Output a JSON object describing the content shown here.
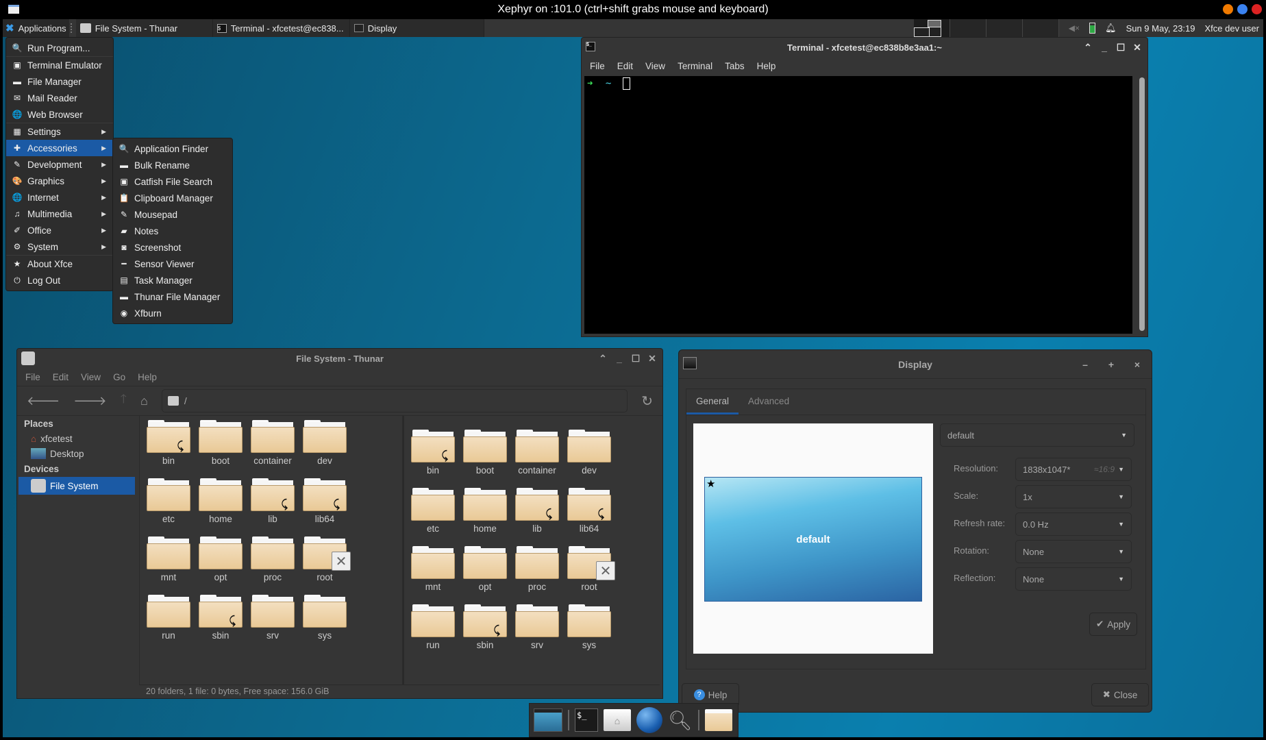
{
  "xephyr": {
    "title": "Xephyr on :101.0 (ctrl+shift grabs mouse and keyboard)",
    "dots": [
      "#f07a00",
      "#3a82f0",
      "#dd2222"
    ]
  },
  "panel": {
    "applications_label": "Applications",
    "tasks": [
      {
        "label": "File System - Thunar",
        "icon": "drive-icon"
      },
      {
        "label": "Terminal - xfcetest@ec838...",
        "icon": "terminal-icon"
      },
      {
        "label": "Display",
        "icon": "monitor-icon"
      }
    ],
    "clock": "Sun  9 May, 23:19",
    "user": "Xfce dev user"
  },
  "app_menu": {
    "items": [
      {
        "label": "Run Program...",
        "icon": "search-icon",
        "glyph": "🔍"
      },
      {
        "label": "Terminal Emulator",
        "icon": "terminal-icon",
        "glyph": "▣"
      },
      {
        "label": "File Manager",
        "icon": "folder-icon",
        "glyph": "▬"
      },
      {
        "label": "Mail Reader",
        "icon": "mail-icon",
        "glyph": "✉"
      },
      {
        "label": "Web Browser",
        "icon": "globe-icon",
        "glyph": "🌐"
      },
      {
        "label": "Settings",
        "icon": "settings-icon",
        "glyph": "▦",
        "submenu": true
      },
      {
        "label": "Accessories",
        "icon": "accessories-icon",
        "glyph": "✚",
        "submenu": true,
        "selected": true
      },
      {
        "label": "Development",
        "icon": "development-icon",
        "glyph": "✎",
        "submenu": true
      },
      {
        "label": "Graphics",
        "icon": "palette-icon",
        "glyph": "🎨",
        "submenu": true
      },
      {
        "label": "Internet",
        "icon": "globe-icon",
        "glyph": "🌐",
        "submenu": true
      },
      {
        "label": "Multimedia",
        "icon": "multimedia-icon",
        "glyph": "♫",
        "submenu": true
      },
      {
        "label": "Office",
        "icon": "office-icon",
        "glyph": "✐",
        "submenu": true
      },
      {
        "label": "System",
        "icon": "gear-icon",
        "glyph": "⚙",
        "submenu": true
      },
      {
        "label": "About Xfce",
        "icon": "star-icon",
        "glyph": "★"
      },
      {
        "label": "Log Out",
        "icon": "power-icon",
        "glyph": "⏻"
      }
    ]
  },
  "accessories_menu": {
    "items": [
      {
        "label": "Application Finder",
        "icon": "search-icon",
        "glyph": "🔍"
      },
      {
        "label": "Bulk Rename",
        "icon": "folder-icon",
        "glyph": "▬"
      },
      {
        "label": "Catfish File Search",
        "icon": "catfish-icon",
        "glyph": "▣"
      },
      {
        "label": "Clipboard Manager",
        "icon": "clipboard-icon",
        "glyph": "📋"
      },
      {
        "label": "Mousepad",
        "icon": "text-editor-icon",
        "glyph": "✎"
      },
      {
        "label": "Notes",
        "icon": "notes-icon",
        "glyph": "▰"
      },
      {
        "label": "Screenshot",
        "icon": "camera-icon",
        "glyph": "◙"
      },
      {
        "label": "Sensor Viewer",
        "icon": "sensor-icon",
        "glyph": "━"
      },
      {
        "label": "Task Manager",
        "icon": "task-manager-icon",
        "glyph": "▤"
      },
      {
        "label": "Thunar File Manager",
        "icon": "folder-icon",
        "glyph": "▬"
      },
      {
        "label": "Xfburn",
        "icon": "disc-icon",
        "glyph": "◉"
      }
    ]
  },
  "terminal": {
    "title": "Terminal - xfcetest@ec838b8e3aa1:~",
    "menu": [
      "File",
      "Edit",
      "View",
      "Terminal",
      "Tabs",
      "Help"
    ],
    "prompt_arrow": "➜",
    "prompt_dir": "~"
  },
  "thunar": {
    "title": "File System - Thunar",
    "menu": [
      "File",
      "Edit",
      "View",
      "Go",
      "Help"
    ],
    "path": "/",
    "places_heading": "Places",
    "places": [
      "xfcetest",
      "Desktop"
    ],
    "devices_heading": "Devices",
    "devices": [
      "File System"
    ],
    "folders": [
      {
        "name": "bin",
        "link": true
      },
      {
        "name": "boot"
      },
      {
        "name": "container"
      },
      {
        "name": "dev"
      },
      {
        "name": "etc"
      },
      {
        "name": "home"
      },
      {
        "name": "lib",
        "link": true
      },
      {
        "name": "lib64",
        "link": true
      },
      {
        "name": "mnt"
      },
      {
        "name": "opt"
      },
      {
        "name": "proc"
      },
      {
        "name": "root",
        "noaccess": true
      },
      {
        "name": "run"
      },
      {
        "name": "sbin",
        "link": true
      },
      {
        "name": "srv"
      },
      {
        "name": "sys"
      }
    ],
    "status": "20 folders, 1 file: 0 bytes, Free space: 156.0 GiB"
  },
  "display": {
    "title": "Display",
    "tabs": [
      "General",
      "Advanced"
    ],
    "monitor_label": "default",
    "output_select": "default",
    "fields": [
      {
        "label": "Resolution:",
        "value": "1838x1047*",
        "hint": "≈16:9"
      },
      {
        "label": "Scale:",
        "value": "1x"
      },
      {
        "label": "Refresh rate:",
        "value": "0.0 Hz"
      },
      {
        "label": "Rotation:",
        "value": "None"
      },
      {
        "label": "Reflection:",
        "value": "None"
      }
    ],
    "apply_label": "Apply",
    "help_label": "Help",
    "close_label": "Close"
  },
  "dock": {
    "items": [
      "show-desktop-icon",
      "terminal-icon",
      "home-folder-icon",
      "web-browser-icon",
      "app-finder-icon",
      "folder-icon"
    ]
  }
}
